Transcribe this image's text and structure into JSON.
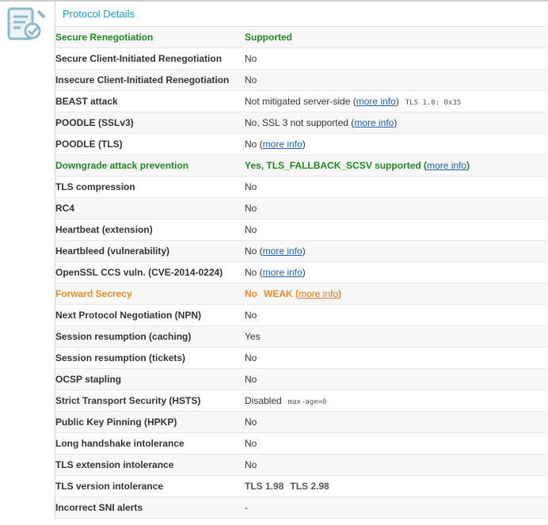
{
  "section": {
    "title": "Protocol Details",
    "icon": "document-check-icon",
    "accent": "#1a99c9"
  },
  "colors": {
    "good": "#218721",
    "warn": "#f08a24",
    "link": "#1d5fb3"
  },
  "rows": [
    {
      "label": "Secure Renegotiation",
      "value": "Supported"
    },
    {
      "label": "Secure Client-Initiated Renegotiation",
      "value": "No"
    },
    {
      "label": "Insecure Client-Initiated Renegotiation",
      "value": "No"
    },
    {
      "label": "BEAST attack",
      "value": "Not mitigated server-side (",
      "link": "more info",
      "after": ")",
      "note": "TLS 1.0: 0x35"
    },
    {
      "label": "POODLE (SSLv3)",
      "value": "No, SSL 3 not supported (",
      "link": "more info",
      "after": ")"
    },
    {
      "label": "POODLE (TLS)",
      "value": "No (",
      "link": "more info",
      "after": ")"
    },
    {
      "label": "Downgrade attack prevention",
      "value": "Yes, TLS_FALLBACK_SCSV supported (",
      "link": "more info",
      "after": ")"
    },
    {
      "label": "TLS compression",
      "value": "No"
    },
    {
      "label": "RC4",
      "value": "No"
    },
    {
      "label": "Heartbeat (extension)",
      "value": "No"
    },
    {
      "label": "Heartbleed (vulnerability)",
      "value": "No (",
      "link": "more info",
      "after": ")"
    },
    {
      "label": "OpenSSL CCS vuln. (CVE-2014-0224)",
      "value": "No (",
      "link": "more info",
      "after": ")"
    },
    {
      "label": "Forward Secrecy",
      "value": "No",
      "value2": "WEAK (",
      "link": "more info",
      "after": ")"
    },
    {
      "label": "Next Protocol Negotiation (NPN)",
      "value": "No"
    },
    {
      "label": "Session resumption (caching)",
      "value": "Yes"
    },
    {
      "label": "Session resumption (tickets)",
      "value": "No"
    },
    {
      "label": "OCSP stapling",
      "value": "No"
    },
    {
      "label": "Strict Transport Security (HSTS)",
      "value": "Disabled",
      "note": "max-age=0"
    },
    {
      "label": "Public Key Pinning (HPKP)",
      "value": "No"
    },
    {
      "label": "Long handshake intolerance",
      "value": "No"
    },
    {
      "label": "TLS extension intolerance",
      "value": "No"
    },
    {
      "label": "TLS version intolerance",
      "value": "TLS 1.98",
      "value2": "TLS 2.98"
    },
    {
      "label": "Incorrect SNI alerts",
      "value": "-"
    }
  ]
}
